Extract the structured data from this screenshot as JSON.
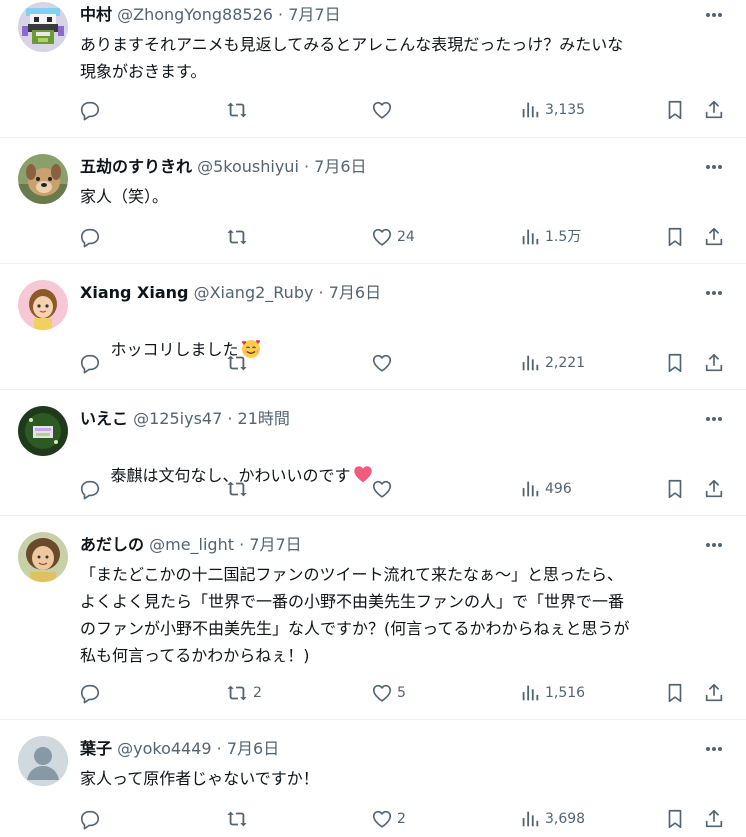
{
  "colors": {
    "text": "#0f1419",
    "secondary": "#536471",
    "divider": "#eff3f4",
    "heart_emoji": "#f25a7e"
  },
  "tweets": [
    {
      "name": "中村",
      "handle": "@ZhongYong88526",
      "dot": "·",
      "time": "7月7日",
      "text": "ありますそれアニメも見返してみるとアレこんな表現だったっけ？みたいな\n現象がおきます。",
      "replies": "",
      "retweets": "",
      "likes": "",
      "views": "3,135",
      "avatar_icon": "pixel-art-avatar"
    },
    {
      "name": "五劫のすりきれ",
      "handle": "@5koushiyui",
      "dot": "·",
      "time": "7月6日",
      "text": "家人（笑）。",
      "replies": "",
      "retweets": "",
      "likes": "24",
      "views": "1.5万",
      "avatar_icon": "dog-photo-avatar"
    },
    {
      "name": "Xiang Xiang",
      "handle": "@Xiang2_Ruby",
      "dot": "·",
      "time": "7月6日",
      "text": "ホッコリしました",
      "emoji": "smiling-face-with-hearts-emoji",
      "replies": "",
      "retweets": "",
      "likes": "",
      "views": "2,221",
      "avatar_icon": "cartoon-girl-avatar"
    },
    {
      "name": "いえこ",
      "handle": "@125iys47",
      "dot": "·",
      "time": "21時間",
      "text": "泰麒は文句なし、かわいいのです",
      "emoji": "pink-heart-emoji",
      "replies": "",
      "retweets": "",
      "likes": "",
      "views": "496",
      "avatar_icon": "green-illustration-avatar"
    },
    {
      "name": "あだしの",
      "handle": "@me_light",
      "dot": "·",
      "time": "7月7日",
      "text": "「またどこかの十二国記ファンのツイート流れて来たなぁ～」と思ったら、\nよくよく見たら「世界で一番の小野不由美先生ファンの人」で「世界で一番\nのファンが小野不由美先生」な人ですか？(何言ってるかわからねぇと思うが\n私も何言ってるかわからねぇ！)",
      "replies": "",
      "retweets": "2",
      "likes": "5",
      "views": "1,516",
      "avatar_icon": "portrait-photo-avatar"
    },
    {
      "name": "葉子",
      "handle": "@yoko4449",
      "dot": "·",
      "time": "7月6日",
      "text": "家人って原作者じゃないですか！",
      "replies": "",
      "retweets": "",
      "likes": "2",
      "views": "3,698",
      "avatar_icon": "default-user-avatar"
    }
  ]
}
